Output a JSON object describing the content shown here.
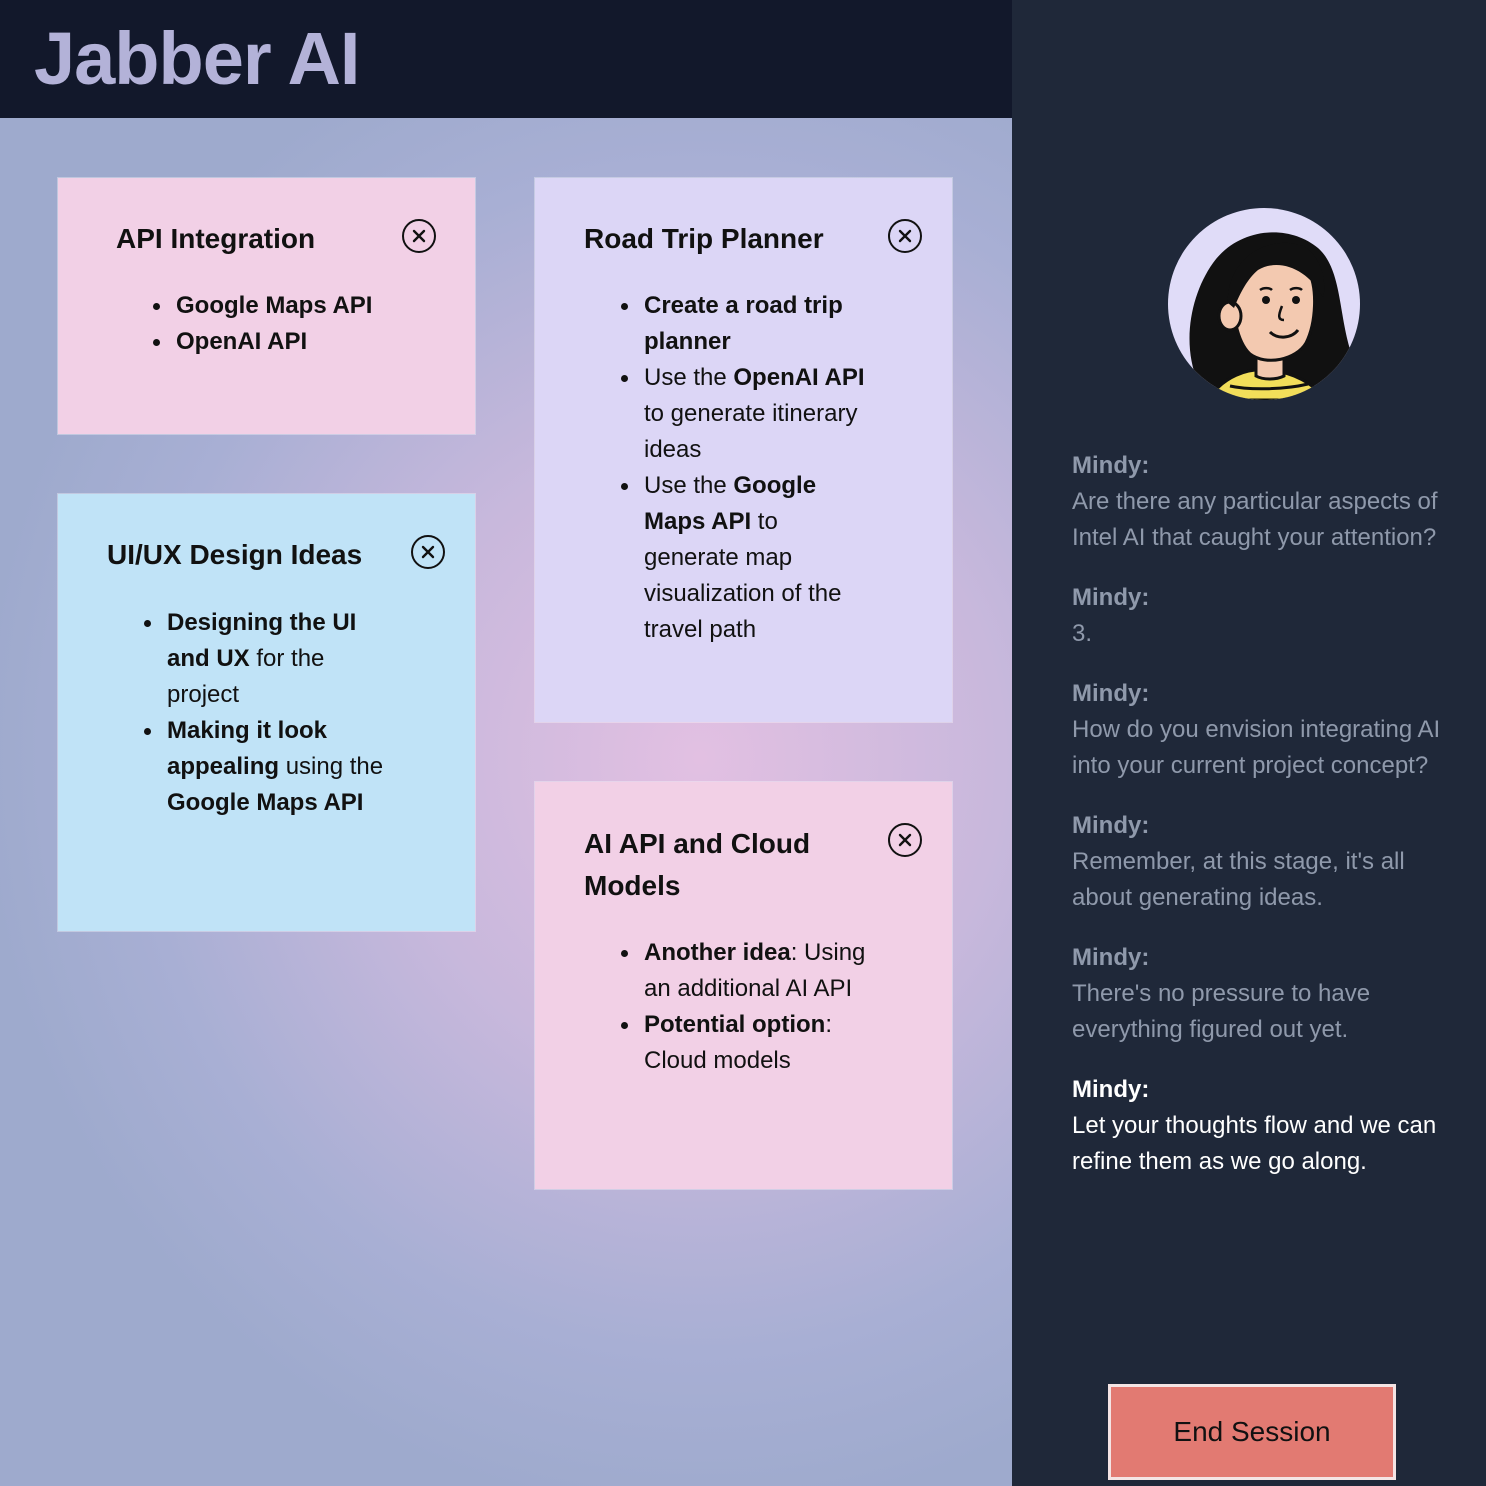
{
  "app": {
    "title": "Jabber AI"
  },
  "notes": [
    {
      "title": "API Integration",
      "items": [
        [
          {
            "t": "Google Maps API",
            "b": true
          }
        ],
        [
          {
            "t": "OpenAI API",
            "b": true
          }
        ]
      ]
    },
    {
      "title": "UI/UX Design Ideas",
      "items": [
        [
          {
            "t": "Designing the UI and UX",
            "b": true
          },
          {
            "t": " for the project",
            "b": false
          }
        ],
        [
          {
            "t": "Making it look appealing",
            "b": true
          },
          {
            "t": " using the ",
            "b": false
          },
          {
            "t": "Google Maps API",
            "b": true
          }
        ]
      ]
    },
    {
      "title": "Road Trip Planner",
      "items": [
        [
          {
            "t": "Create a road trip planner",
            "b": true
          }
        ],
        [
          {
            "t": "Use the ",
            "b": false
          },
          {
            "t": "OpenAI API",
            "b": true
          },
          {
            "t": " to generate itinerary ideas",
            "b": false
          }
        ],
        [
          {
            "t": "Use the ",
            "b": false
          },
          {
            "t": "Google Maps API",
            "b": true
          },
          {
            "t": " to generate map visualization of the travel path",
            "b": false
          }
        ]
      ]
    },
    {
      "title": "AI API and Cloud Models",
      "items": [
        [
          {
            "t": "Another idea",
            "b": true
          },
          {
            "t": ": Using an additional AI API",
            "b": false
          }
        ],
        [
          {
            "t": "Potential option",
            "b": true
          },
          {
            "t": ": Cloud models",
            "b": false
          }
        ]
      ]
    }
  ],
  "chat": {
    "messages": [
      {
        "speaker": "Mindy:",
        "text": "Are there any particular aspects of Intel AI that caught your attention?"
      },
      {
        "speaker": "Mindy:",
        "text": "3."
      },
      {
        "speaker": "Mindy:",
        "text": "How do you envision integrating AI into your current project concept?"
      },
      {
        "speaker": "Mindy:",
        "text": "Remember, at this stage, it's all about generating ideas."
      },
      {
        "speaker": "Mindy:",
        "text": "There's no pressure to have everything figured out yet."
      },
      {
        "speaker": "Mindy:",
        "text": "Let your thoughts flow and we can refine them as we go along."
      }
    ],
    "end_session_label": "End Session"
  },
  "colors": {
    "note_pink": "#f2d0e6",
    "note_lavender": "#dcd6f6",
    "note_blue": "#c0e3f7",
    "end_button": "#e27a72",
    "sidebar": "#1f2839",
    "topbar": "#12182b"
  },
  "icons": {
    "note_close": "close-circle-icon"
  }
}
